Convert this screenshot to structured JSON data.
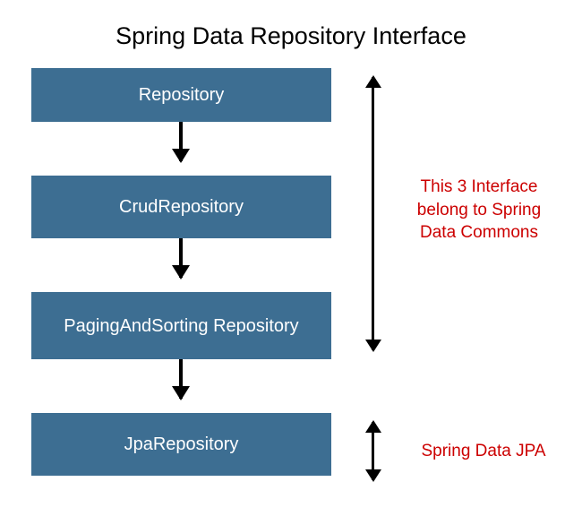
{
  "title": "Spring Data Repository Interface",
  "boxes": {
    "b1": "Repository",
    "b2": "CrudRepository",
    "b3": "PagingAndSorting Repository",
    "b4": "JpaRepository"
  },
  "annotations": {
    "a1": "This 3 Interface belong to Spring Data Commons",
    "a2": "Spring Data JPA"
  },
  "colors": {
    "box_bg": "#3d6e92",
    "box_text": "#ffffff",
    "annotation_text": "#cc0000"
  }
}
